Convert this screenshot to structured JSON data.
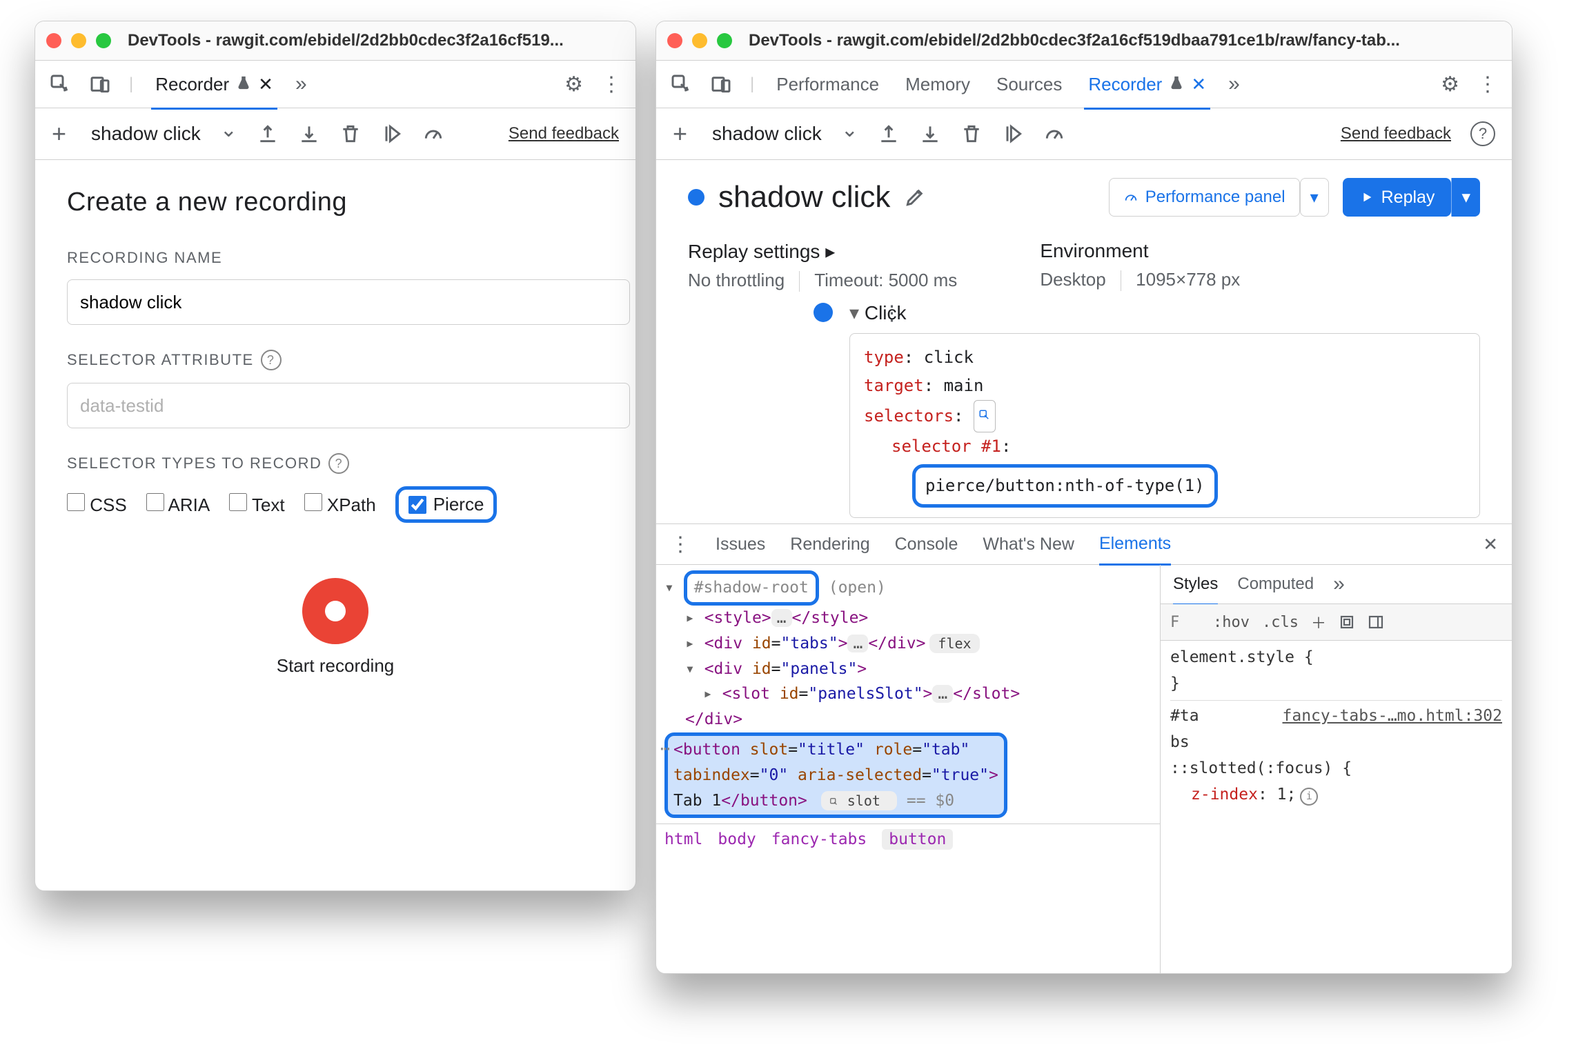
{
  "left": {
    "title": "DevTools - rawgit.com/ebidel/2d2bb0cdec3f2a16cf519...",
    "tab_recorder": "Recorder",
    "toolbar": {
      "name": "shadow click",
      "send_feedback": "Send feedback"
    },
    "h1": "Create a new recording",
    "labels": {
      "recording_name": "RECORDING NAME",
      "selector_attribute": "SELECTOR ATTRIBUTE",
      "selector_types": "SELECTOR TYPES TO RECORD"
    },
    "name_input_value": "shadow click",
    "attr_placeholder": "data-testid",
    "selector_types": {
      "css": "CSS",
      "aria": "ARIA",
      "text": "Text",
      "xpath": "XPath",
      "pierce": "Pierce"
    },
    "start_recording": "Start recording"
  },
  "right": {
    "title": "DevTools - rawgit.com/ebidel/2d2bb0cdec3f2a16cf519dbaa791ce1b/raw/fancy-tab...",
    "tabs": {
      "performance": "Performance",
      "memory": "Memory",
      "sources": "Sources",
      "recorder": "Recorder"
    },
    "toolbar": {
      "name": "shadow click",
      "send_feedback": "Send feedback"
    },
    "recording_title": "shadow click",
    "perf_panel_btn": "Performance panel",
    "replay_btn": "Replay",
    "replay_settings": {
      "title": "Replay settings",
      "throttling": "No throttling",
      "timeout": "Timeout: 5000 ms"
    },
    "environment": {
      "title": "Environment",
      "device": "Desktop",
      "dimensions": "1095×778 px"
    },
    "step": {
      "name": "Click",
      "props": {
        "type_k": "type",
        "type_v": "click",
        "target_k": "target",
        "target_v": "main",
        "selectors_k": "selectors",
        "selector_n": "selector #1",
        "selector_val": "pierce/button:nth-of-type(1)"
      }
    },
    "drawer": {
      "tabs": {
        "issues": "Issues",
        "rendering": "Rendering",
        "console": "Console",
        "whatsnew": "What's New",
        "elements": "Elements"
      },
      "dom": {
        "shadow_root": "#shadow-root",
        "shadow_mode": "(open)",
        "style_tag": "<style>",
        "style_close": "</style>",
        "tabs_div_open": "<div id=\"tabs\">",
        "tabs_div_close": "</div>",
        "tabs_flex": "flex",
        "panels_open": "<div id=\"panels\">",
        "slot_open": "<slot id=\"panelsSlot\">",
        "slot_close": "</slot>",
        "div_close": "</div>",
        "btn_open": "<button slot=\"title\" role=\"tab\" tabindex=\"0\" aria-selected=\"true\">",
        "btn_text": "Tab 1",
        "btn_close": "</button>",
        "reveal_badge": "slot",
        "dollar0": "== $0"
      },
      "crumbs": {
        "html": "html",
        "body": "body",
        "fancy": "fancy-tabs",
        "button": "button"
      },
      "styles": {
        "tabs": {
          "styles": "Styles",
          "computed": "Computed"
        },
        "filter_placeholder": "F",
        "hov": ":hov",
        "cls": ".cls",
        "element_style": "element.style {",
        "close_brace": "}",
        "rule_sel": "#ta\nbs",
        "rule_src": "fancy-tabs-…mo.html:302",
        "slotted_sel": "::slotted(:focus) {",
        "zindex_k": "z-index",
        "zindex_v": "1;"
      }
    }
  }
}
